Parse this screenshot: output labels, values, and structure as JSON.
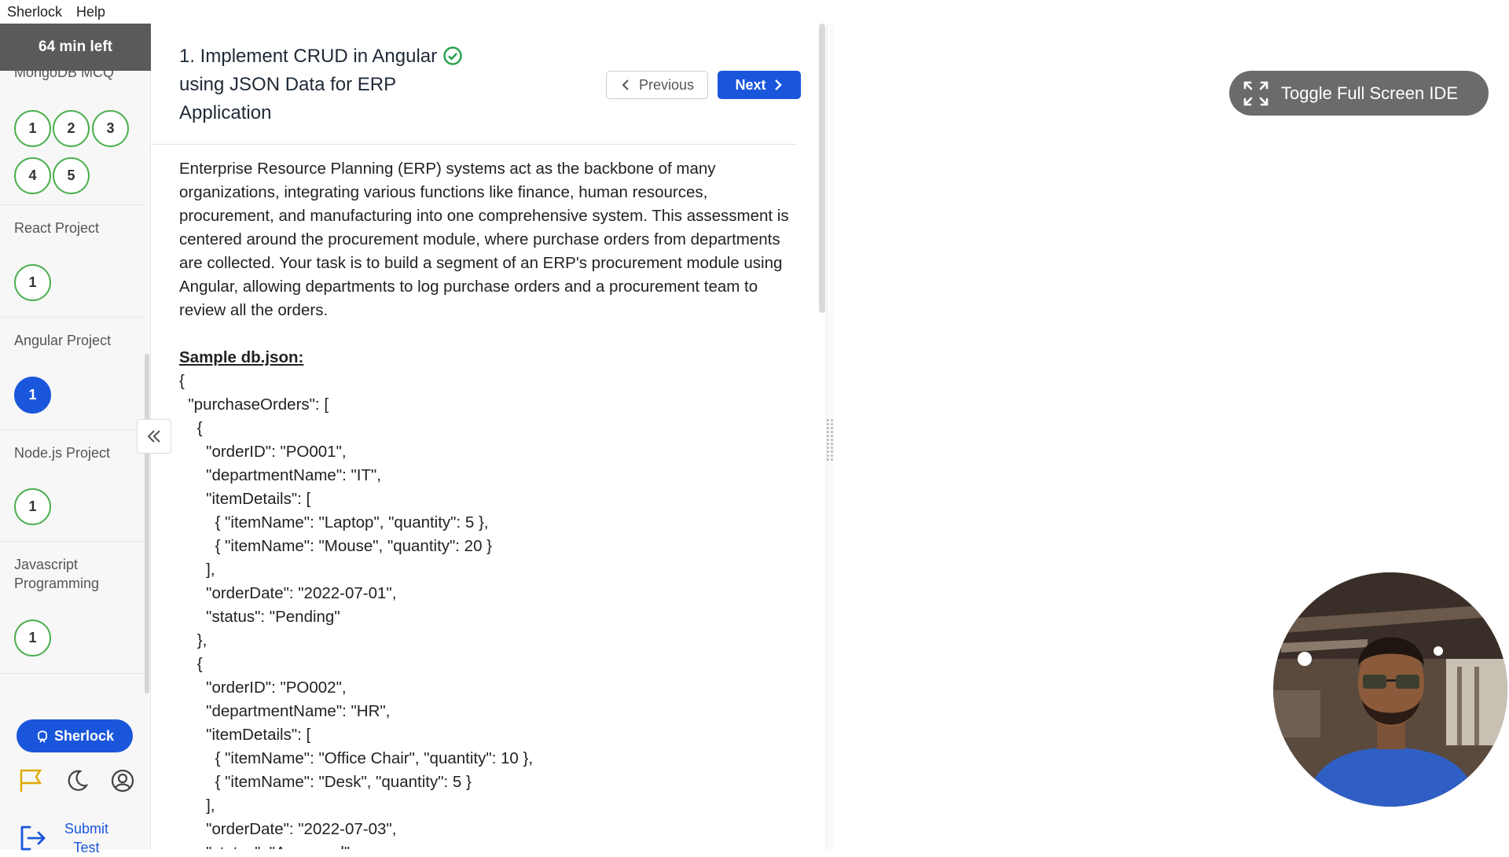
{
  "menubar": {
    "items": [
      "Sherlock",
      "Help"
    ]
  },
  "sidebar": {
    "timer": "64 min left",
    "sections": [
      {
        "title": "MongoDB MCQ",
        "questions": [
          "1",
          "2",
          "3",
          "4",
          "5"
        ]
      },
      {
        "title": "React Project",
        "questions": [
          "1"
        ]
      },
      {
        "title": "Angular Project",
        "questions": [
          "1"
        ],
        "active_question": "1"
      },
      {
        "title": "Node.js Project",
        "questions": [
          "1"
        ]
      },
      {
        "title": "Javascript Programming",
        "questions": [
          "1"
        ]
      }
    ],
    "sherlock_button": "Sherlock",
    "submit_label": "Submit Test",
    "icons": [
      "flag-icon",
      "moon-icon",
      "user-circle-icon",
      "logout-icon",
      "collapse-icon"
    ]
  },
  "question": {
    "title": "1. Implement CRUD in Angular using JSON Data for ERP Application",
    "completed": true,
    "prev_label": "Previous",
    "next_label": "Next",
    "description": "Enterprise Resource Planning (ERP) systems act as the backbone of many organizations, integrating various functions like finance, human resources, procurement, and manufacturing into one comprehensive system. This assessment is centered around the procurement module, where purchase orders from departments are collected. Your task is to build a segment of an ERP's procurement module using Angular, allowing departments to log purchase orders and a procurement team to review all the orders.",
    "sample_heading": "Sample db.json:",
    "sample_code": "{\n  \"purchaseOrders\": [\n    {\n      \"orderID\": \"PO001\",\n      \"departmentName\": \"IT\",\n      \"itemDetails\": [\n        { \"itemName\": \"Laptop\", \"quantity\": 5 },\n        { \"itemName\": \"Mouse\", \"quantity\": 20 }\n      ],\n      \"orderDate\": \"2022-07-01\",\n      \"status\": \"Pending\"\n    },\n    {\n      \"orderID\": \"PO002\",\n      \"departmentName\": \"HR\",\n      \"itemDetails\": [\n        { \"itemName\": \"Office Chair\", \"quantity\": 10 },\n        { \"itemName\": \"Desk\", \"quantity\": 5 }\n      ],\n      \"orderDate\": \"2022-07-03\",\n      \"status\": \"Approved\""
  },
  "ide": {
    "toggle_label": "Toggle Full Screen IDE"
  },
  "colors": {
    "primary": "#1a56db",
    "success": "#4caf50",
    "timer_bg": "#5a5a5a",
    "toggle_bg": "#6b6b6b"
  }
}
